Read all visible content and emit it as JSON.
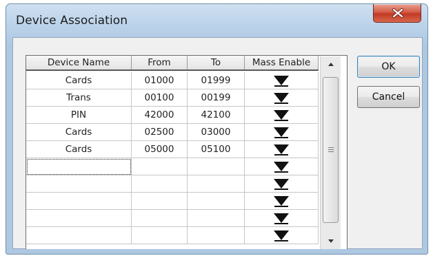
{
  "window": {
    "title": "Device Association"
  },
  "table": {
    "columns": [
      "Device Name",
      "From",
      "To",
      "Mass Enable"
    ],
    "rows": [
      [
        "Cards",
        "01000",
        "01999"
      ],
      [
        "Trans",
        "00100",
        "00199"
      ],
      [
        "PIN",
        "42000",
        "42100"
      ],
      [
        "Cards",
        "02500",
        "03000"
      ],
      [
        "Cards",
        "05000",
        "05100"
      ],
      [
        "",
        "",
        ""
      ],
      [
        "",
        "",
        ""
      ],
      [
        "",
        "",
        ""
      ],
      [
        "",
        "",
        ""
      ],
      [
        "",
        "",
        ""
      ]
    ]
  },
  "buttons": {
    "ok": "OK",
    "cancel": "Cancel"
  },
  "icons": {
    "close": "close-icon",
    "dropdown": "dropdown-arrow-icon",
    "scroll_up": "scroll-up-arrow-icon",
    "scroll_down": "scroll-down-arrow-icon"
  },
  "colors": {
    "close_button": "#c94a35",
    "window_frame": "#bcd3ea"
  }
}
